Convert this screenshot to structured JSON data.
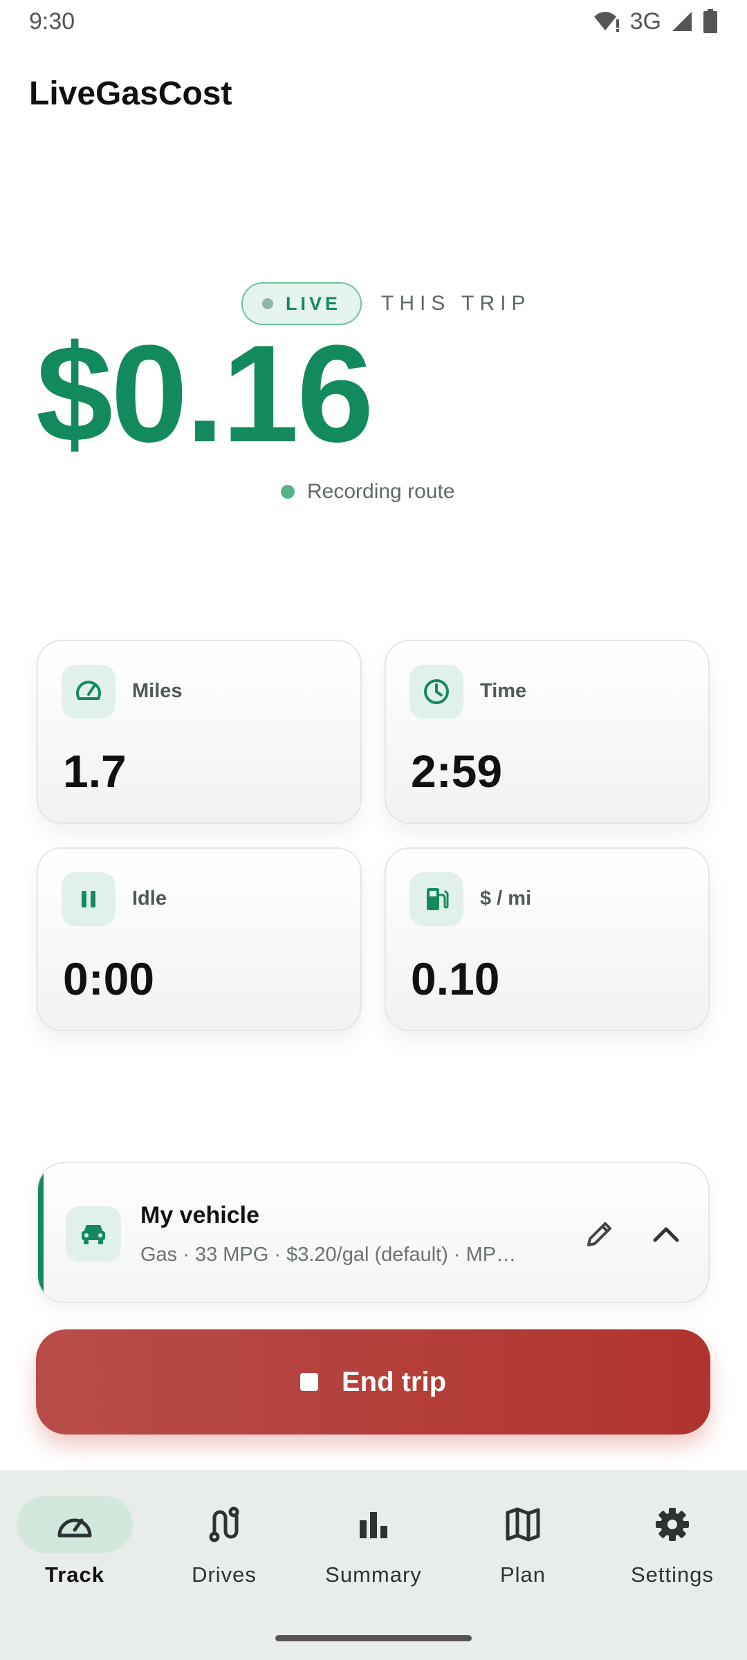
{
  "status_bar": {
    "time": "9:30",
    "network": "3G"
  },
  "app": {
    "title": "LiveGasCost"
  },
  "hero": {
    "live_label": "LIVE",
    "trip_label": "THIS TRIP",
    "cost": "$0.16",
    "recording": "Recording route"
  },
  "stats": [
    {
      "label": "Miles",
      "value": "1.7",
      "icon": "speedometer-icon"
    },
    {
      "label": "Time",
      "value": "2:59",
      "icon": "clock-icon"
    },
    {
      "label": "Idle",
      "value": "0:00",
      "icon": "pause-icon"
    },
    {
      "label": "$ / mi",
      "value": "0.10",
      "icon": "fuel-pump-icon"
    }
  ],
  "vehicle": {
    "title": "My vehicle",
    "details": "Gas · 33 MPG · $3.20/gal (default) · MP…"
  },
  "end_trip": {
    "label": "End trip"
  },
  "nav": {
    "items": [
      {
        "label": "Track",
        "icon": "speedometer-icon",
        "active": true
      },
      {
        "label": "Drives",
        "icon": "route-icon"
      },
      {
        "label": "Summary",
        "icon": "bar-chart-icon"
      },
      {
        "label": "Plan",
        "icon": "map-icon"
      },
      {
        "label": "Settings",
        "icon": "gear-icon"
      }
    ]
  },
  "colors": {
    "accent": "#138a5e",
    "end_trip": "#b0342d",
    "nav_background": "#e9ede9"
  }
}
